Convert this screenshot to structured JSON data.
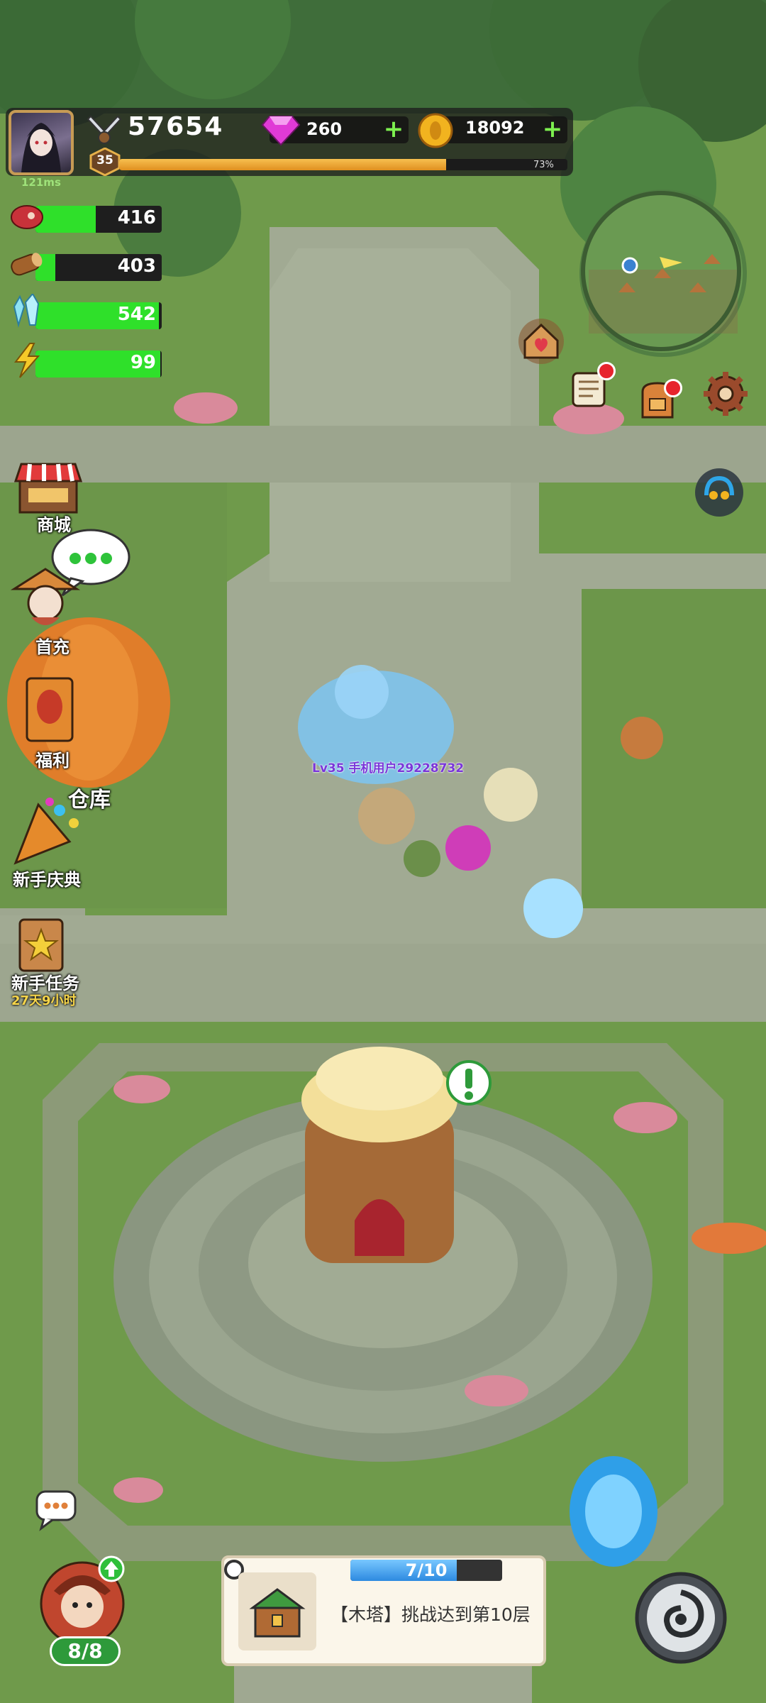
{
  "player": {
    "ping": "121ms",
    "power": "57654",
    "level": "35",
    "xp_percent_label": "73%",
    "xp_fraction": 0.73
  },
  "currency": {
    "gems": "260",
    "gold": "18092"
  },
  "resources": [
    {
      "name": "meat",
      "icon": "meat-icon",
      "value": "416",
      "fill": 0.48
    },
    {
      "name": "wood",
      "icon": "wood-icon",
      "value": "403",
      "fill": 0.16
    },
    {
      "name": "crystal",
      "icon": "crystal-icon",
      "value": "542",
      "fill": 0.98
    },
    {
      "name": "energy",
      "icon": "lightning-icon",
      "value": "99",
      "fill": 0.99
    }
  ],
  "left_menu": {
    "shop": "商城",
    "first_recharge": "首充",
    "welfare": "福利",
    "warehouse": "仓库",
    "newbie_celebration": "新手庆典",
    "newbie_tasks": "新手任务",
    "newbie_tasks_timer": "27天9小时"
  },
  "map": {
    "player_tag": "Lv35 手机用户29228732"
  },
  "quest": {
    "progress_label": "7/10",
    "progress_fraction": 0.7,
    "text": "【木塔】挑战达到第10层"
  },
  "team": {
    "count": "8/8"
  },
  "colors": {
    "accent_green": "#2fe02a",
    "xp_orange": "#f0a22f",
    "gem_pink": "#e03ad6",
    "gold": "#f2b31f",
    "notification_red": "#e7242d"
  }
}
